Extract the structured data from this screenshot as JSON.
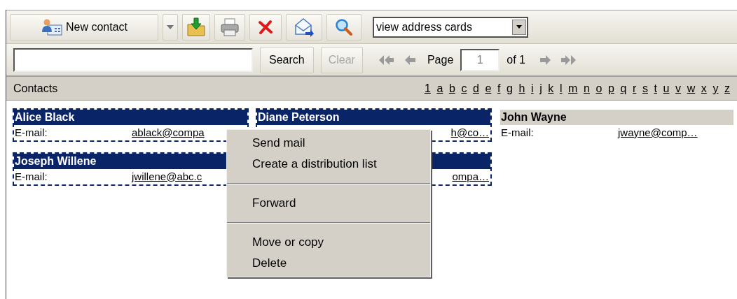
{
  "toolbar": {
    "new_contact": "New contact",
    "view_select": "view address cards"
  },
  "search_bar": {
    "search_button": "Search",
    "clear_button": {
      "label": "Clear",
      "disabled": true
    },
    "page_label": "Page",
    "page_value": "1",
    "page_total": "of 1"
  },
  "contacts_header": {
    "title": "Contacts",
    "letters": [
      "1",
      "a",
      "b",
      "c",
      "d",
      "e",
      "f",
      "g",
      "h",
      "i",
      "j",
      "k",
      "l",
      "m",
      "n",
      "o",
      "p",
      "q",
      "r",
      "s",
      "t",
      "u",
      "v",
      "w",
      "x",
      "y",
      "z"
    ]
  },
  "card_columns": [
    {
      "cards": [
        {
          "name": "Alice Black",
          "email_label": "E-mail:",
          "email": "ablack@compa",
          "selected": true
        },
        {
          "name": "Joseph Willene",
          "email_label": "E-mail:",
          "email": "jwillene@abc.c",
          "selected": true
        }
      ]
    },
    {
      "cards": [
        {
          "name": "Diane Peterson",
          "email": "h@co…",
          "selected": true
        },
        {
          "email": "ompa…",
          "selected": true
        }
      ]
    },
    {
      "cards": [
        {
          "name": "John Wayne",
          "email_label": "E-mail:",
          "email": "jwayne@comp…",
          "selected": false
        }
      ]
    }
  ],
  "context_menu": {
    "groups": [
      [
        "Send mail",
        "Create a distribution list"
      ],
      [
        "Forward"
      ],
      [
        "Move or copy",
        "Delete"
      ]
    ]
  }
}
